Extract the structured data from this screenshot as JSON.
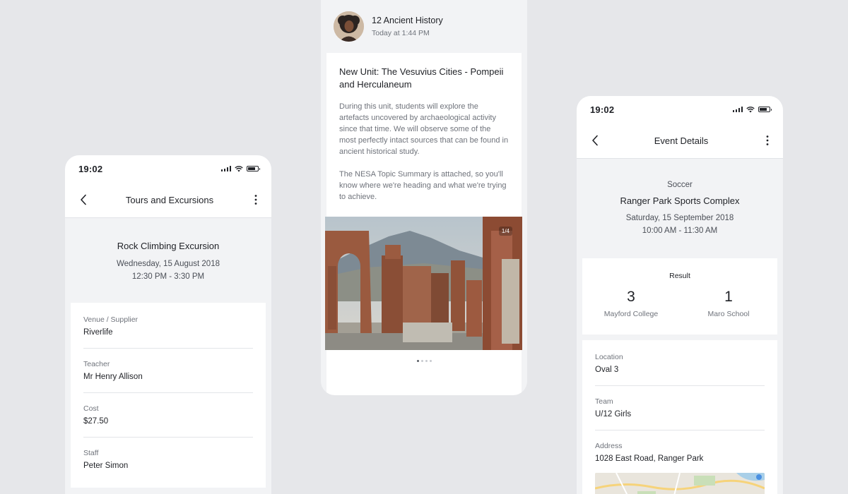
{
  "left_phone": {
    "status_time": "19:02",
    "nav_title": "Tours and Excursions",
    "hero": {
      "title": "Rock Climbing Excursion",
      "date": "Wednesday, 15 August 2018",
      "time": "12:30 PM - 3:30 PM"
    },
    "fields": [
      {
        "label": "Venue / Supplier",
        "value": "Riverlife"
      },
      {
        "label": "Teacher",
        "value": "Mr Henry Allison"
      },
      {
        "label": "Cost",
        "value": "$27.50"
      },
      {
        "label": "Staff",
        "value": "Peter Simon"
      }
    ]
  },
  "middle_phone": {
    "author": "12 Ancient History",
    "timestamp": "Today at 1:44 PM",
    "post_title": "New Unit: The Vesuvius Cities - Pompeii and Herculaneum",
    "post_paragraph_1": "During this unit, students will explore the artefacts uncovered by archaeological activity since that time. We will observe some of the most perfectly intact sources that can be found in ancient historical study.",
    "post_paragraph_2": "The NESA Topic Summary is attached, so you'll know where we're heading and what we're trying to achieve.",
    "gallery_counter": "1/4",
    "gallery_page_count": 4,
    "gallery_active_index": 0
  },
  "right_phone": {
    "status_time": "19:02",
    "nav_title": "Event Details",
    "hero": {
      "category": "Soccer",
      "title": "Ranger Park Sports Complex",
      "date": "Saturday, 15 September 2018",
      "time": "10:00 AM - 11:30 AM"
    },
    "result": {
      "label": "Result",
      "home_score": "3",
      "home_team": "Mayford College",
      "away_score": "1",
      "away_team": "Maro School"
    },
    "fields": [
      {
        "label": "Location",
        "value": "Oval 3"
      },
      {
        "label": "Team",
        "value": "U/12 Girls"
      },
      {
        "label": "Address",
        "value": "1028 East Road, Ranger Park"
      }
    ]
  },
  "colors": {
    "background": "#e6e7ea",
    "screen_background": "#f2f3f5",
    "card": "#ffffff",
    "text_primary": "#1f2126",
    "text_secondary": "#6f737b"
  }
}
